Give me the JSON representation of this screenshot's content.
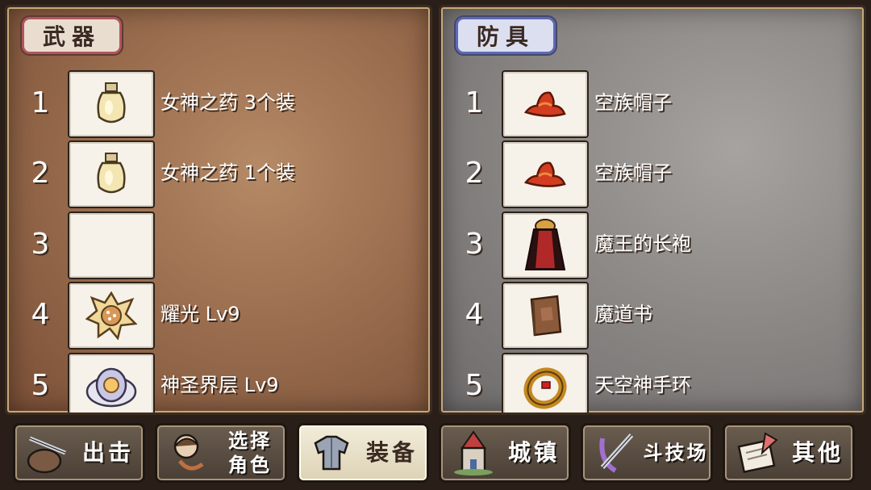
{
  "weapon_panel": {
    "title": "武器",
    "slots": [
      {
        "number": "1",
        "item": "女神之药 3个装",
        "icon": "potion-bottle-icon"
      },
      {
        "number": "2",
        "item": "女神之药 1个装",
        "icon": "potion-bottle-icon"
      },
      {
        "number": "3",
        "item": "",
        "icon": "empty"
      },
      {
        "number": "4",
        "item": "耀光 Lv9",
        "icon": "radiant-shell-icon"
      },
      {
        "number": "5",
        "item": "神圣界层 Lv9",
        "icon": "holy-shield-icon"
      }
    ]
  },
  "armor_panel": {
    "title": "防具",
    "slots": [
      {
        "number": "1",
        "item": "空族帽子",
        "icon": "red-hat-icon"
      },
      {
        "number": "2",
        "item": "空族帽子",
        "icon": "red-hat-icon"
      },
      {
        "number": "3",
        "item": "魔王的长袍",
        "icon": "demon-robe-icon"
      },
      {
        "number": "4",
        "item": "魔道书",
        "icon": "spellbook-icon"
      },
      {
        "number": "5",
        "item": "天空神手环",
        "icon": "gold-bracelet-icon"
      }
    ]
  },
  "nav": {
    "sortie": "出击",
    "select_character": "选择\n角色",
    "equipment": "装备",
    "town": "城镇",
    "arena": "斗技场",
    "other": "其他"
  },
  "colors": {
    "weapon_panel_bg": "#9b6e4f",
    "armor_panel_bg": "#8d8986",
    "active_tab": "#f2ecd9"
  }
}
